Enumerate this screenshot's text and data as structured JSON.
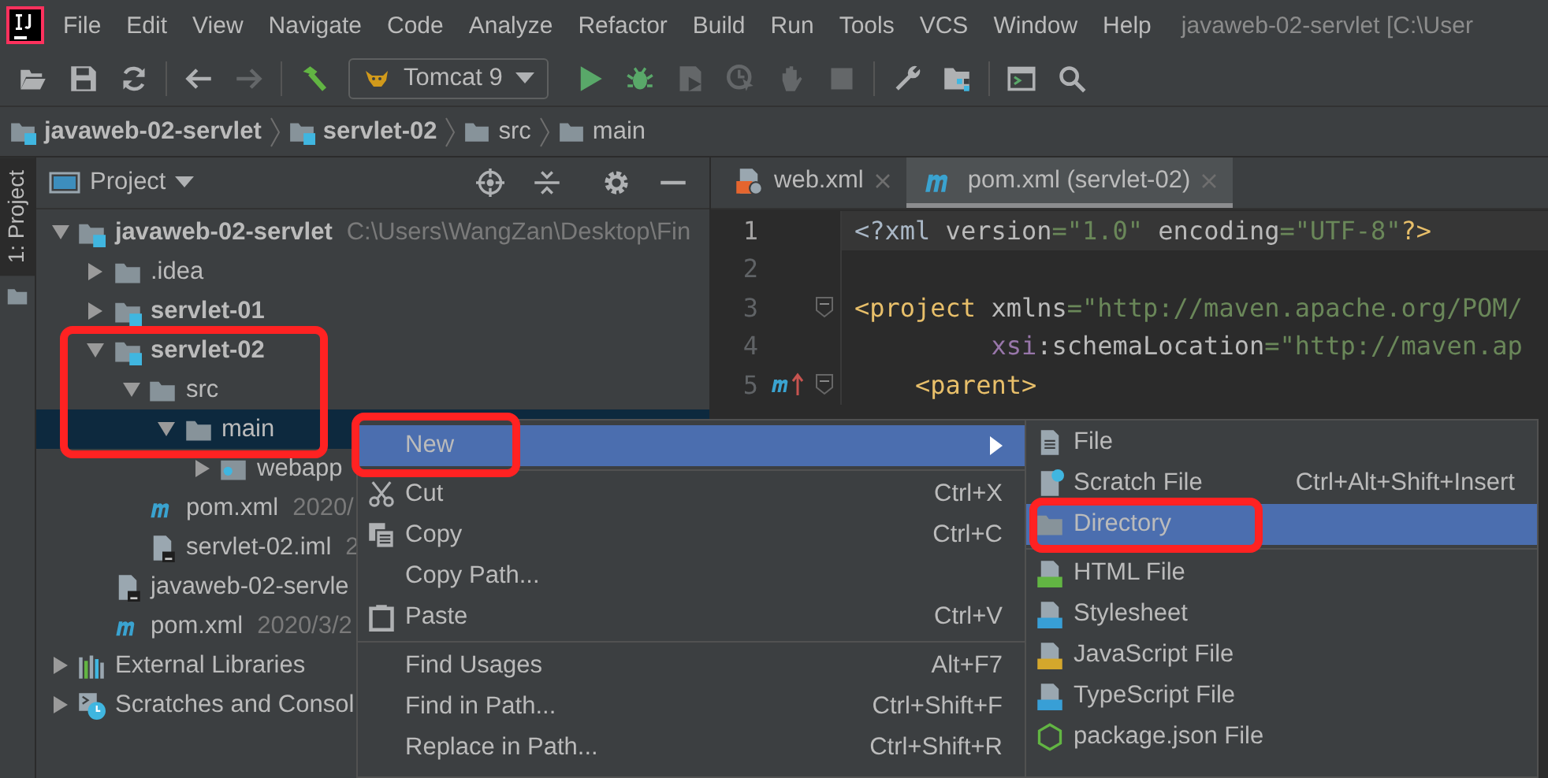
{
  "menu_bar": {
    "items": [
      "File",
      "Edit",
      "View",
      "Navigate",
      "Code",
      "Analyze",
      "Refactor",
      "Build",
      "Run",
      "Tools",
      "VCS",
      "Window",
      "Help"
    ],
    "title": "javaweb-02-servlet [C:\\User"
  },
  "toolbar": [
    {
      "kind": "open",
      "disabled": false
    },
    {
      "kind": "save",
      "disabled": false
    },
    {
      "kind": "sync",
      "disabled": false
    },
    {
      "kind": "separator"
    },
    {
      "kind": "back",
      "disabled": false
    },
    {
      "kind": "forward",
      "disabled": true
    },
    {
      "kind": "separator"
    },
    {
      "kind": "build",
      "disabled": false
    },
    {
      "kind": "run-config",
      "label": "Tomcat 9"
    },
    {
      "kind": "run",
      "disabled": false
    },
    {
      "kind": "debug",
      "disabled": false
    },
    {
      "kind": "coverage",
      "disabled": true
    },
    {
      "kind": "profile",
      "disabled": true
    },
    {
      "kind": "attach",
      "disabled": true
    },
    {
      "kind": "stop",
      "disabled": true
    },
    {
      "kind": "separator"
    },
    {
      "kind": "settings",
      "disabled": false
    },
    {
      "kind": "structure",
      "disabled": false
    },
    {
      "kind": "separator"
    },
    {
      "kind": "terminal",
      "disabled": false
    },
    {
      "kind": "search",
      "disabled": false
    }
  ],
  "breadcrumbs": [
    {
      "label": "javaweb-02-servlet",
      "kind": "module"
    },
    {
      "label": "servlet-02",
      "kind": "module"
    },
    {
      "label": "src",
      "kind": "folder"
    },
    {
      "label": "main",
      "kind": "folder"
    }
  ],
  "side_tab": {
    "label": "1: Project",
    "selected": true
  },
  "project": {
    "title": "Project",
    "tree": [
      {
        "label": "javaweb-02-servlet",
        "hint": "C:\\Users\\WangZan\\Desktop\\Fin",
        "kind": "module",
        "expanded": true,
        "selected": false,
        "children": [
          {
            "label": ".idea",
            "kind": "folder",
            "expanded": false,
            "selected": false
          },
          {
            "label": "servlet-01",
            "kind": "module",
            "expanded": false,
            "selected": false
          },
          {
            "label": "servlet-02",
            "kind": "module",
            "expanded": true,
            "selected": false,
            "children": [
              {
                "label": "src",
                "kind": "folder",
                "expanded": true,
                "selected": false,
                "children": [
                  {
                    "label": "main",
                    "kind": "folder",
                    "expanded": true,
                    "selected": true,
                    "children": [
                      {
                        "label": "webapp",
                        "kind": "web-folder",
                        "expanded": false,
                        "selected": false
                      }
                    ]
                  }
                ]
              },
              {
                "label": "pom.xml",
                "hint": "2020/",
                "kind": "pom",
                "selected": false
              },
              {
                "label": "servlet-02.iml",
                "hint": "2",
                "kind": "iml",
                "selected": false
              }
            ]
          },
          {
            "label": "javaweb-02-servle",
            "kind": "iml",
            "selected": false
          },
          {
            "label": "pom.xml",
            "hint": "2020/3/2",
            "kind": "pom",
            "selected": false
          }
        ]
      },
      {
        "label": "External Libraries",
        "kind": "libraries",
        "expanded": false,
        "selected": false
      },
      {
        "label": "Scratches and Consol",
        "kind": "scratches",
        "expanded": false,
        "selected": false
      }
    ]
  },
  "editor": {
    "tabs": [
      {
        "label": "web.xml",
        "kind": "web-xml",
        "selected": false
      },
      {
        "label": "pom.xml (servlet-02)",
        "kind": "pom",
        "selected": true
      }
    ],
    "lines": [
      {
        "number": "1",
        "current": true,
        "fold": false,
        "overridden": false,
        "tokens": [
          {
            "kind": "plain",
            "text": "<?xml"
          },
          {
            "kind": "attr",
            "text": " version"
          },
          {
            "kind": "str",
            "text": "=\"1.0\""
          },
          {
            "kind": "attr",
            "text": " encoding"
          },
          {
            "kind": "str",
            "text": "=\"UTF-8\""
          },
          {
            "kind": "tag",
            "text": "?>"
          }
        ]
      },
      {
        "number": "2",
        "current": false,
        "fold": false,
        "overridden": false
      },
      {
        "number": "3",
        "current": false,
        "fold": true,
        "overridden": false,
        "tokens": [
          {
            "kind": "tag",
            "text": "<project"
          },
          {
            "kind": "attr",
            "text": " xmlns"
          },
          {
            "kind": "str",
            "text": "=\"http://maven.apache.org/POM/"
          }
        ]
      },
      {
        "number": "4",
        "current": false,
        "fold": false,
        "overridden": false,
        "tokens": [
          {
            "kind": "ns",
            "text": "         xsi"
          },
          {
            "kind": "attr",
            "text": ":schemaLocation"
          },
          {
            "kind": "str",
            "text": "=\"http://maven.ap"
          }
        ]
      },
      {
        "number": "5",
        "current": false,
        "fold": true,
        "overridden": true,
        "tokens": [
          {
            "kind": "tag",
            "text": "    <parent>"
          }
        ]
      }
    ]
  },
  "context_menu": {
    "items": [
      {
        "kind": "item",
        "label": "New",
        "submenu": true,
        "selected": true
      },
      {
        "kind": "separator"
      },
      {
        "kind": "cut",
        "label": "Cut",
        "shortcut": "Ctrl+X",
        "selected": false
      },
      {
        "kind": "copy",
        "label": "Copy",
        "shortcut": "Ctrl+C",
        "selected": false
      },
      {
        "kind": "item",
        "label": "Copy Path...",
        "selected": false
      },
      {
        "kind": "paste",
        "label": "Paste",
        "shortcut": "Ctrl+V",
        "selected": false
      },
      {
        "kind": "separator"
      },
      {
        "kind": "item",
        "label": "Find Usages",
        "shortcut": "Alt+F7",
        "selected": false
      },
      {
        "kind": "item",
        "label": "Find in Path...",
        "shortcut": "Ctrl+Shift+F",
        "selected": false
      },
      {
        "kind": "item",
        "label": "Replace in Path...",
        "shortcut": "Ctrl+Shift+R",
        "selected": false
      }
    ]
  },
  "submenu": {
    "items": [
      {
        "kind": "file",
        "label": "File",
        "selected": false
      },
      {
        "kind": "scratch",
        "label": "Scratch File",
        "shortcut": "Ctrl+Alt+Shift+Insert",
        "selected": false
      },
      {
        "kind": "folder",
        "label": "Directory",
        "selected": true
      },
      {
        "kind": "separator"
      },
      {
        "kind": "html",
        "label": "HTML File",
        "selected": false
      },
      {
        "kind": "css",
        "label": "Stylesheet",
        "selected": false
      },
      {
        "kind": "js",
        "label": "JavaScript File",
        "selected": false
      },
      {
        "kind": "ts",
        "label": "TypeScript File",
        "selected": false
      },
      {
        "kind": "node",
        "label": "package.json File",
        "selected": false
      }
    ]
  }
}
